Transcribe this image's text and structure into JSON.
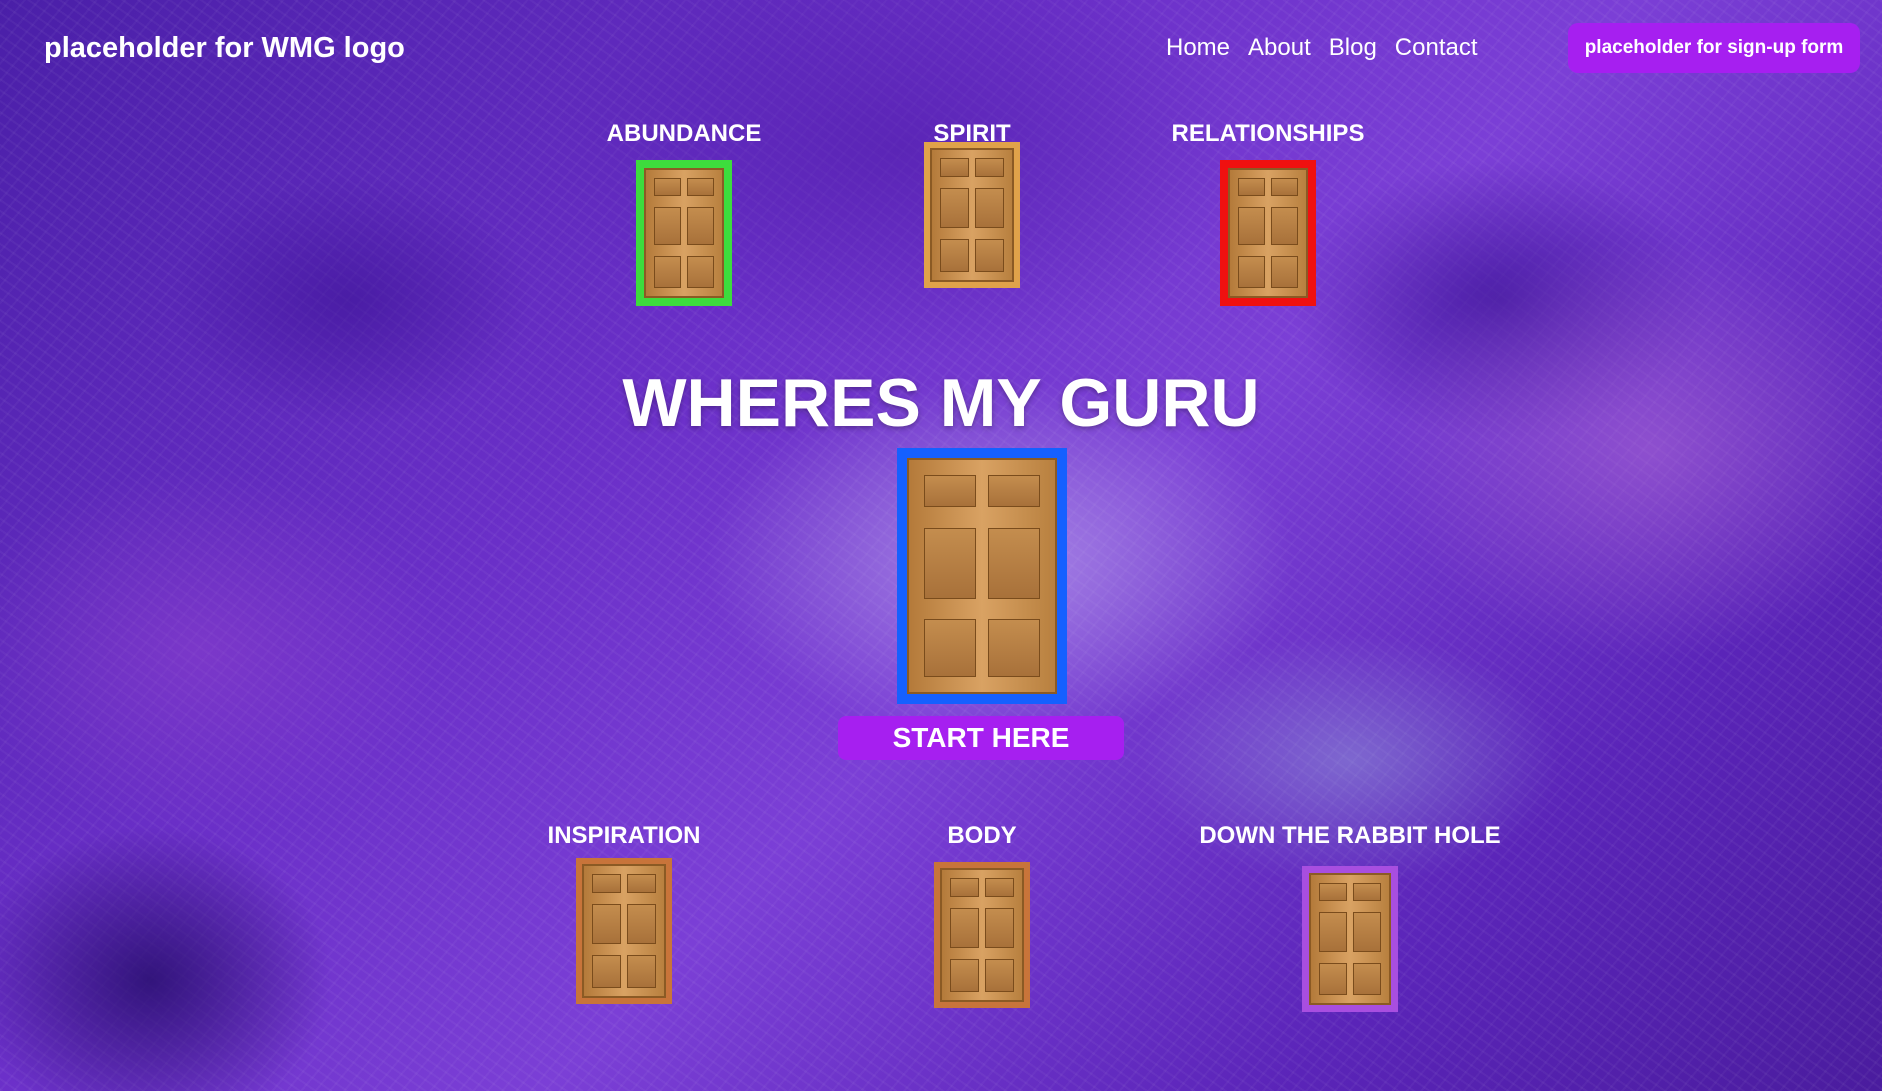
{
  "nav": {
    "logo": "placeholder for WMG logo",
    "links": [
      "Home",
      "About",
      "Blog",
      "Contact"
    ],
    "signup": "placeholder for sign-up form"
  },
  "hero": {
    "title": "WHERES MY GURU",
    "start_label": "START HERE",
    "main_door_color": "#1560ff"
  },
  "doors": [
    {
      "label": "ABUNDANCE",
      "frame_color": "#3ddc3d"
    },
    {
      "label": "SPIRIT",
      "frame_color": "#e0a24a"
    },
    {
      "label": "RELATIONSHIPS",
      "frame_color": "#f01010"
    },
    {
      "label": "INSPIRATION",
      "frame_color": "#c8743a"
    },
    {
      "label": "BODY",
      "frame_color": "#c8743a"
    },
    {
      "label": "DOWN THE RABBIT HOLE",
      "frame_color": "#a84ee0"
    }
  ],
  "colors": {
    "accent": "#a61ff0"
  }
}
